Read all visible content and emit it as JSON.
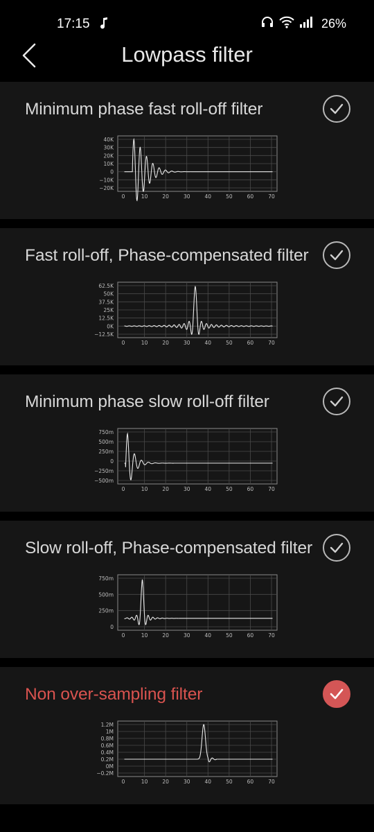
{
  "status": {
    "time": "17:15",
    "battery": "26%"
  },
  "header": {
    "title": "Lowpass filter"
  },
  "colors": {
    "accent": "#d45656",
    "card_bg": "#161616",
    "page_bg": "#000000"
  },
  "filters": [
    {
      "name": "Minimum phase fast roll-off filter",
      "selected": false
    },
    {
      "name": "Fast roll-off, Phase-compensated filter",
      "selected": false
    },
    {
      "name": "Minimum phase slow roll-off filter",
      "selected": false
    },
    {
      "name": "Slow roll-off, Phase-compensated filter",
      "selected": false
    },
    {
      "name": "Non over-sampling filter",
      "selected": true
    }
  ],
  "chart_data": [
    {
      "type": "line",
      "x_ticks": [
        "0",
        "10",
        "20",
        "30",
        "40",
        "50",
        "60",
        "70"
      ],
      "y_ticks": [
        "40K",
        "30K",
        "20K",
        "10K",
        "0",
        "−10K",
        "−20K"
      ],
      "xlim": [
        0,
        70
      ],
      "ylim": [
        -20000,
        40000
      ],
      "grid": true,
      "response": {
        "kind": "min_fast",
        "peak_x": 5,
        "peak_y": 40000
      }
    },
    {
      "type": "line",
      "x_ticks": [
        "0",
        "10",
        "20",
        "30",
        "40",
        "50",
        "60",
        "70"
      ],
      "y_ticks": [
        "62.5K",
        "50K",
        "37.5K",
        "25K",
        "12.5K",
        "0K",
        "−12.5K"
      ],
      "xlim": [
        0,
        70
      ],
      "ylim": [
        -12500,
        62500
      ],
      "grid": true,
      "response": {
        "kind": "linear_fast",
        "peak_x": 34,
        "peak_y": 61000
      }
    },
    {
      "type": "line",
      "x_ticks": [
        "0",
        "10",
        "20",
        "30",
        "40",
        "50",
        "60",
        "70"
      ],
      "y_ticks": [
        "750m",
        "500m",
        "250m",
        "0",
        "−250m",
        "−500m"
      ],
      "xlim": [
        0,
        70
      ],
      "ylim": [
        -0.5,
        0.9
      ],
      "grid": true,
      "response": {
        "kind": "min_slow",
        "peak_x": 2,
        "peak_y": 0.85
      }
    },
    {
      "type": "line",
      "x_ticks": [
        "0",
        "10",
        "20",
        "30",
        "40",
        "50",
        "60",
        "70"
      ],
      "y_ticks": [
        "750m",
        "500m",
        "250m",
        "0"
      ],
      "xlim": [
        0,
        70
      ],
      "ylim": [
        -0.2,
        0.95
      ],
      "grid": true,
      "response": {
        "kind": "linear_slow",
        "peak_x": 9,
        "peak_y": 0.92
      }
    },
    {
      "type": "line",
      "x_ticks": [
        "0",
        "10",
        "20",
        "30",
        "40",
        "50",
        "60",
        "70"
      ],
      "y_ticks": [
        "1.2M",
        "1M",
        "0.8M",
        "0.6M",
        "0.4M",
        "0.2M",
        "0M",
        "−0.2M"
      ],
      "xlim": [
        0,
        70
      ],
      "ylim": [
        -0.2,
        1.2
      ],
      "grid": true,
      "response": {
        "kind": "nos",
        "peak_x": 38,
        "peak_y": 1.2,
        "baseline_y": 0.2
      }
    }
  ]
}
